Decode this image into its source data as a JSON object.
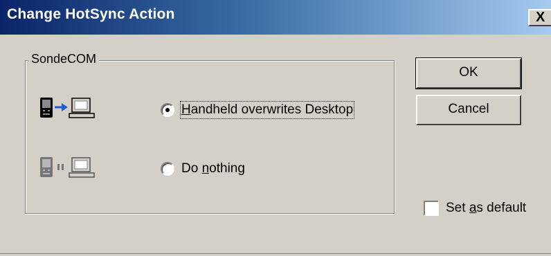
{
  "dialog": {
    "title": "Change HotSync Action",
    "close_glyph": "X"
  },
  "group": {
    "label": "SondeCOM"
  },
  "options": [
    {
      "label_before": "",
      "label_accel": "H",
      "label_after": "andheld overwrites Desktop",
      "selected": true,
      "icon": "handheld-to-desktop-icon"
    },
    {
      "label_before": "Do ",
      "label_accel": "n",
      "label_after": "othing",
      "selected": false,
      "icon": "do-nothing-icon"
    }
  ],
  "buttons": {
    "ok": "OK",
    "cancel": "Cancel"
  },
  "set_default": {
    "label_before": "Set ",
    "label_accel": "a",
    "label_after": "s default",
    "checked": false
  },
  "colors": {
    "title_gradient_start": "#0a246a",
    "title_gradient_end": "#a6caf0",
    "arrow_blue": "#1e5bd6",
    "face": "#d4d0c8"
  }
}
